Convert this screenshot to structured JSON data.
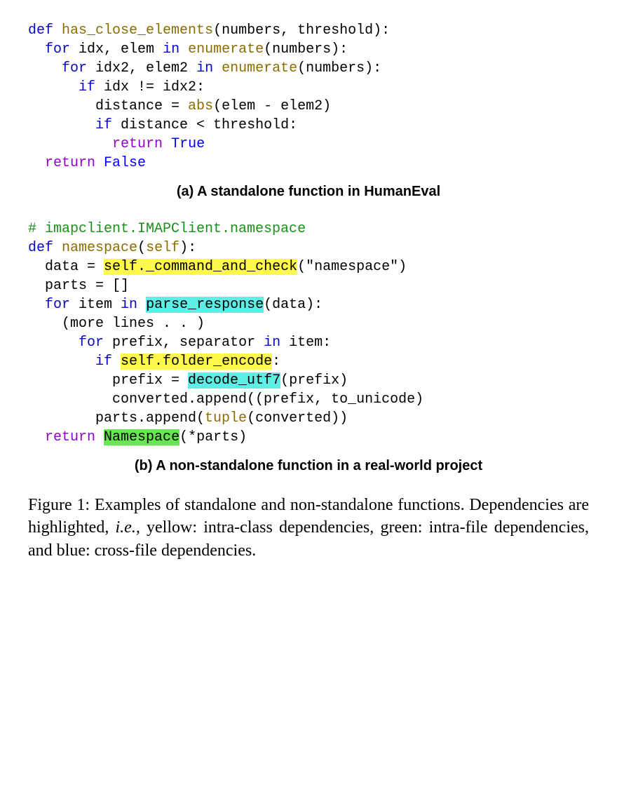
{
  "codeA": {
    "lines": [
      [
        [
          "def ",
          "kw"
        ],
        [
          "has_close_elements",
          "fn"
        ],
        [
          "(numbers, threshold):",
          ""
        ]
      ],
      [
        [
          "  ",
          ""
        ],
        [
          "for",
          "kw"
        ],
        [
          " idx, elem ",
          ""
        ],
        [
          "in",
          "kw"
        ],
        [
          " ",
          ""
        ],
        [
          "enumerate",
          "fn"
        ],
        [
          "(numbers):",
          ""
        ]
      ],
      [
        [
          "    ",
          ""
        ],
        [
          "for",
          "kw"
        ],
        [
          " idx2, elem2 ",
          ""
        ],
        [
          "in",
          "kw"
        ],
        [
          " ",
          ""
        ],
        [
          "enumerate",
          "fn"
        ],
        [
          "(numbers):",
          ""
        ]
      ],
      [
        [
          "      ",
          ""
        ],
        [
          "if",
          "kw"
        ],
        [
          " idx != idx2:",
          ""
        ]
      ],
      [
        [
          "        distance = ",
          ""
        ],
        [
          "abs",
          "fn"
        ],
        [
          "(elem - elem2)",
          ""
        ]
      ],
      [
        [
          "        ",
          ""
        ],
        [
          "if",
          "kw"
        ],
        [
          " distance < threshold:",
          ""
        ]
      ],
      [
        [
          "          ",
          ""
        ],
        [
          "return",
          "kw2"
        ],
        [
          " ",
          ""
        ],
        [
          "True",
          "bi"
        ]
      ],
      [
        [
          "  ",
          ""
        ],
        [
          "return",
          "kw2"
        ],
        [
          " ",
          ""
        ],
        [
          "False",
          "bi"
        ]
      ]
    ]
  },
  "captionA": "(a) A standalone function in HumanEval",
  "codeB": {
    "lines": [
      [
        [
          "# imapclient.IMAPClient.namespace",
          "cmt"
        ]
      ],
      [
        [
          "def ",
          "kw"
        ],
        [
          "namespace",
          "fn"
        ],
        [
          "(",
          ""
        ],
        [
          "self",
          "fn"
        ],
        [
          "):",
          ""
        ]
      ],
      [
        [
          "  data = ",
          ""
        ],
        [
          "self._command_and_check",
          "hl-yellow"
        ],
        [
          "(\"namespace\")",
          ""
        ]
      ],
      [
        [
          "  parts = []",
          ""
        ]
      ],
      [
        [
          "  ",
          ""
        ],
        [
          "for",
          "kw"
        ],
        [
          " item ",
          ""
        ],
        [
          "in",
          "kw"
        ],
        [
          " ",
          ""
        ],
        [
          "parse_response",
          "hl-cyan"
        ],
        [
          "(data):",
          ""
        ]
      ],
      [
        [
          "    (more lines . . )",
          ""
        ]
      ],
      [
        [
          "      ",
          ""
        ],
        [
          "for",
          "kw"
        ],
        [
          " prefix, separator ",
          ""
        ],
        [
          "in",
          "kw"
        ],
        [
          " item:",
          ""
        ]
      ],
      [
        [
          "        ",
          ""
        ],
        [
          "if",
          "kw"
        ],
        [
          " ",
          ""
        ],
        [
          "self.folder_encode",
          "hl-yellow"
        ],
        [
          ":",
          ""
        ]
      ],
      [
        [
          "          prefix = ",
          ""
        ],
        [
          "decode_utf7",
          "hl-cyan"
        ],
        [
          "(prefix)",
          ""
        ]
      ],
      [
        [
          "          converted.append((prefix, to_unicode)",
          ""
        ]
      ],
      [
        [
          "        parts.append(",
          ""
        ],
        [
          "tuple",
          "fn"
        ],
        [
          "(converted))",
          ""
        ]
      ],
      [
        [
          "  ",
          ""
        ],
        [
          "return",
          "kw2"
        ],
        [
          " ",
          ""
        ],
        [
          "Namespace",
          "hl-green"
        ],
        [
          "(*parts)",
          ""
        ]
      ]
    ]
  },
  "captionB": "(b) A non-standalone function in a real-world project",
  "figureCaption": {
    "prefix": "Figure 1: Examples of standalone and non-standalone functions. Dependencies are highlighted, ",
    "ital": "i.e.,",
    "suffix": " yellow: intra-class dependencies, green: intra-file dependencies, and blue: cross-file dependencies."
  }
}
